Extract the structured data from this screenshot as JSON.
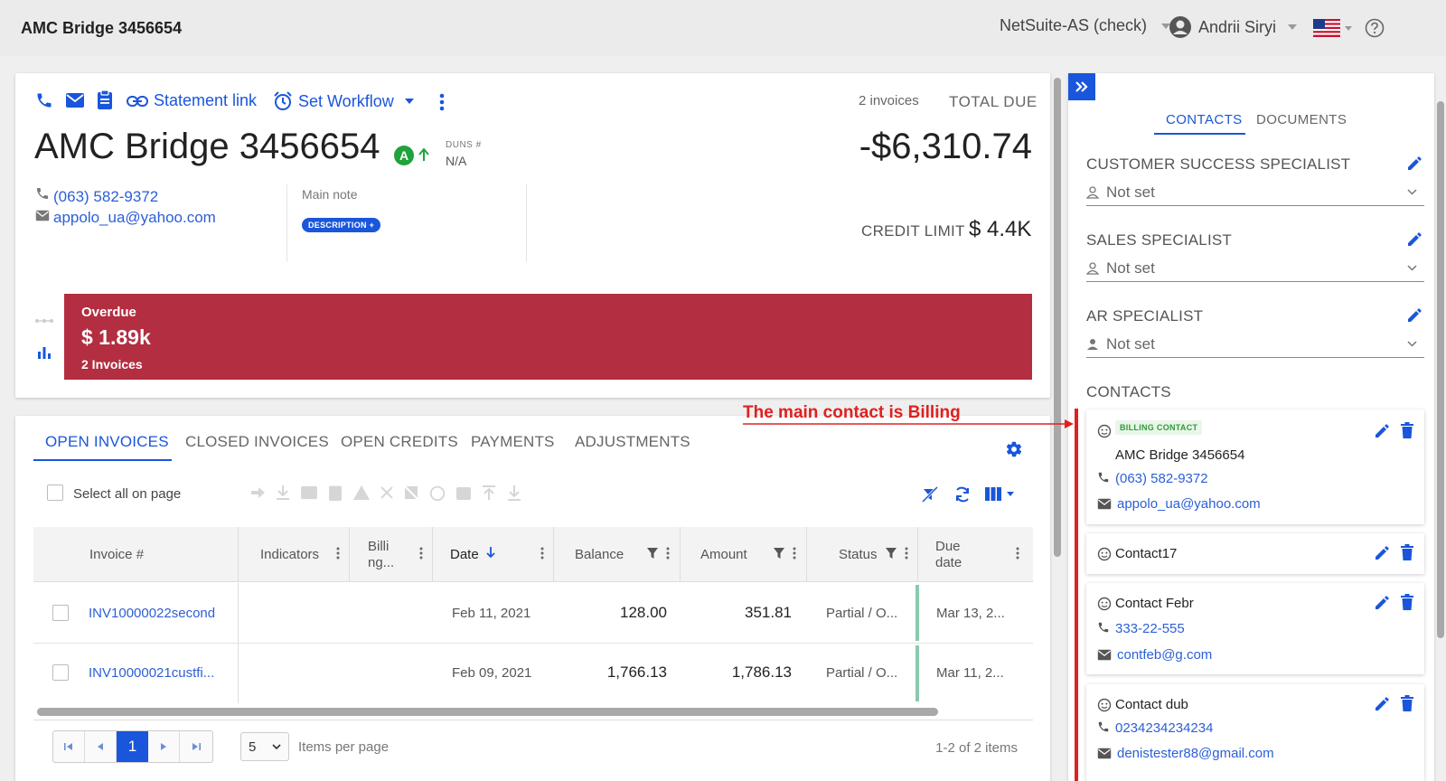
{
  "header": {
    "title": "AMC Bridge 3456654",
    "account": "NetSuite-AS (check)",
    "user": "Andrii Siryi"
  },
  "toolbar": {
    "statement_link": "Statement link",
    "set_workflow": "Set Workflow"
  },
  "customer": {
    "name": "AMC Bridge 3456654",
    "rating": "A",
    "duns_label": "DUNS #",
    "duns_value": "N/A",
    "phone": "(063) 582-9372",
    "email": "appolo_ua@yahoo.com",
    "main_note_label": "Main note",
    "description_badge": "DESCRIPTION +"
  },
  "summary": {
    "invoice_count": "2 invoices",
    "total_due_label": "TOTAL DUE",
    "total_due": "-$6,310.74",
    "credit_limit_label": "CREDIT LIMIT",
    "credit_limit": "$ 4.4K"
  },
  "overdue": {
    "label": "Overdue",
    "amount": "$ 1.89k",
    "invoices": "2 Invoices"
  },
  "tabs": [
    "OPEN INVOICES",
    "CLOSED INVOICES",
    "OPEN CREDITS",
    "PAYMENTS",
    "ADJUSTMENTS"
  ],
  "grid": {
    "select_all": "Select all on page",
    "columns": [
      "Invoice #",
      "Indicators",
      "Billi ng...",
      "Date",
      "Balance",
      "Amount",
      "Status",
      "Due date"
    ],
    "rows": [
      {
        "invoice": "INV10000022second",
        "date": "Feb 11, 2021",
        "balance": "128.00",
        "amount": "351.81",
        "status": "Partial / O...",
        "due": "Mar 13, 2..."
      },
      {
        "invoice": "INV10000021custfi...",
        "date": "Feb 09, 2021",
        "balance": "1,766.13",
        "amount": "1,786.13",
        "status": "Partial / O...",
        "due": "Mar 11, 2..."
      }
    ]
  },
  "pagination": {
    "current_page": "1",
    "page_size": "5",
    "items_per_page": "Items per page",
    "range": "1-2 of 2 items"
  },
  "side": {
    "tabs": [
      "CONTACTS",
      "DOCUMENTS"
    ],
    "sections": [
      {
        "title": "CUSTOMER SUCCESS SPECIALIST",
        "value": "Not set"
      },
      {
        "title": "SALES SPECIALIST",
        "value": "Not set"
      },
      {
        "title": "AR SPECIALIST",
        "value": "Not set"
      }
    ],
    "contacts_title": "CONTACTS",
    "contacts": [
      {
        "badge": "BILLING CONTACT",
        "name": "AMC Bridge 3456654",
        "phone": "(063) 582-9372",
        "email": "appolo_ua@yahoo.com"
      },
      {
        "name": "Contact17"
      },
      {
        "name": "Contact Febr",
        "phone": "333-22-555",
        "email": "contfeb@g.com"
      },
      {
        "name": "Contact dub",
        "phone": "0234234234234",
        "email": "denistester88@gmail.com"
      }
    ]
  },
  "annotation": "The main contact is Billing",
  "colors": {
    "accent": "#1a56db",
    "overdue": "#b22e40",
    "annotation": "#e02020",
    "rating": "#1fa33a"
  }
}
